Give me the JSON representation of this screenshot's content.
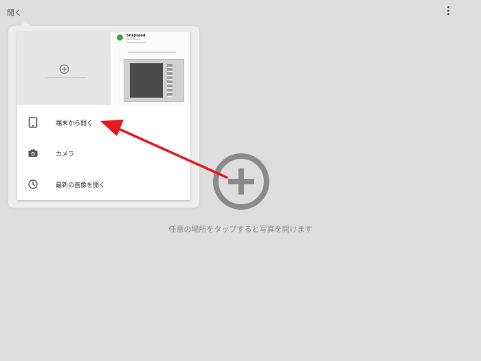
{
  "topbar": {
    "title": "開く",
    "more_icon": "more-vert-icon"
  },
  "popover": {
    "thumbnails": {
      "left_icon": "add-circle-icon",
      "right_app_title": "Snapseed"
    },
    "menu": [
      {
        "label": "端末から開く",
        "icon": "tablet-icon"
      },
      {
        "label": "カメラ",
        "icon": "camera-icon"
      },
      {
        "label": "最新の画像を開く",
        "icon": "clock-icon"
      }
    ]
  },
  "main": {
    "hint": "任意の場所をタップすると写真を開けます",
    "plus_icon": "add-circle-icon"
  },
  "colors": {
    "arrow": "#e8191c",
    "plus": "#8a8a8a",
    "background": "#dddddd"
  }
}
